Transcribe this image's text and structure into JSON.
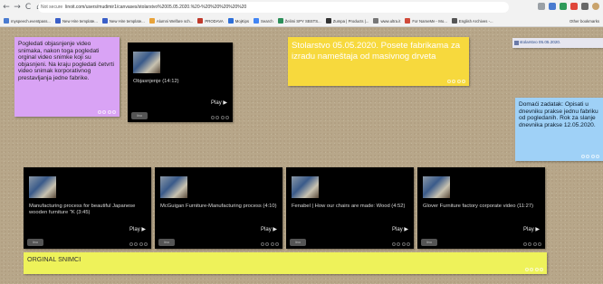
{
  "browser": {
    "nav": {
      "back": "←",
      "forward": "→",
      "reload": "C",
      "home": "⌂"
    },
    "not_secure": "Not secure",
    "url": "linoit.com/users/mudimir1/canvases/stolarstvo%2005.05.2020.%20-%20%20%20%20%20",
    "bookmarks": [
      {
        "label": "myspeech.eventpass...",
        "color": "#4a7bd0"
      },
      {
        "label": "New Hire template...",
        "color": "#3a5fc8"
      },
      {
        "label": "New Hire template...",
        "color": "#3a5fc8"
      },
      {
        "label": "Alumni Welfare sch...",
        "color": "#e8a33a"
      },
      {
        "label": "PRODAVA",
        "color": "#c0392b"
      },
      {
        "label": "MojKips",
        "color": "#2e6fd8"
      },
      {
        "label": "Search",
        "color": "#4285f4"
      },
      {
        "label": "Želimi SPY SBSTS...",
        "color": "#2c8f5a"
      },
      {
        "label": "Zumpa | Products |...",
        "color": "#333333"
      },
      {
        "label": "www.ultra.it",
        "color": "#777777"
      },
      {
        "label": "For NameMe - Mo...",
        "color": "#d04a3a"
      },
      {
        "label": "English Archives -...",
        "color": "#555555"
      }
    ],
    "other_bookmarks": "Other bookmarks"
  },
  "canvas": {
    "purple_note": {
      "text": "Pogledati objasnjenje video snimaka, nakon toga pogledati orginal video snimke koji su objasnjeni. Na kraju pogledati četvrti video snimak korporativnog prestavljanja jedne fabrike."
    },
    "explanation_video": {
      "title": "Objasnjenje (14:12)",
      "play": "Play ▶",
      "logo": "lino"
    },
    "heading_note": {
      "text": "Stolarstvo 05.05.2020. Posete fabrikama za izradu nameštaja od masivnog drveta"
    },
    "small_note": {
      "text": "stolarstvo 05.05.2020."
    },
    "homework_note": {
      "text": "Domaći zadatak: Opisati u dnevniku prakse jednu fabriku od pogledanih. Rok za slanje dnevnika prakse 12.05.2020."
    },
    "videos": [
      {
        "title": "Manufacturing process for beautiful Japanese wooden furniture \"K (3:45)",
        "play": "Play ▶",
        "logo": "lino"
      },
      {
        "title": "McGuigan Furniture-Manufacturing process (4:10)",
        "play": "Play ▶",
        "logo": "lino"
      },
      {
        "title": "Fenabel | How our chairs are made: Wood (4:52)",
        "play": "Play ▶",
        "logo": "lino"
      },
      {
        "title": "Glover Furniture factory corporate video (11:27)",
        "play": "Play ▶",
        "logo": "lino"
      }
    ],
    "original_note": {
      "text": "ORGINAL SNIMCI"
    }
  }
}
